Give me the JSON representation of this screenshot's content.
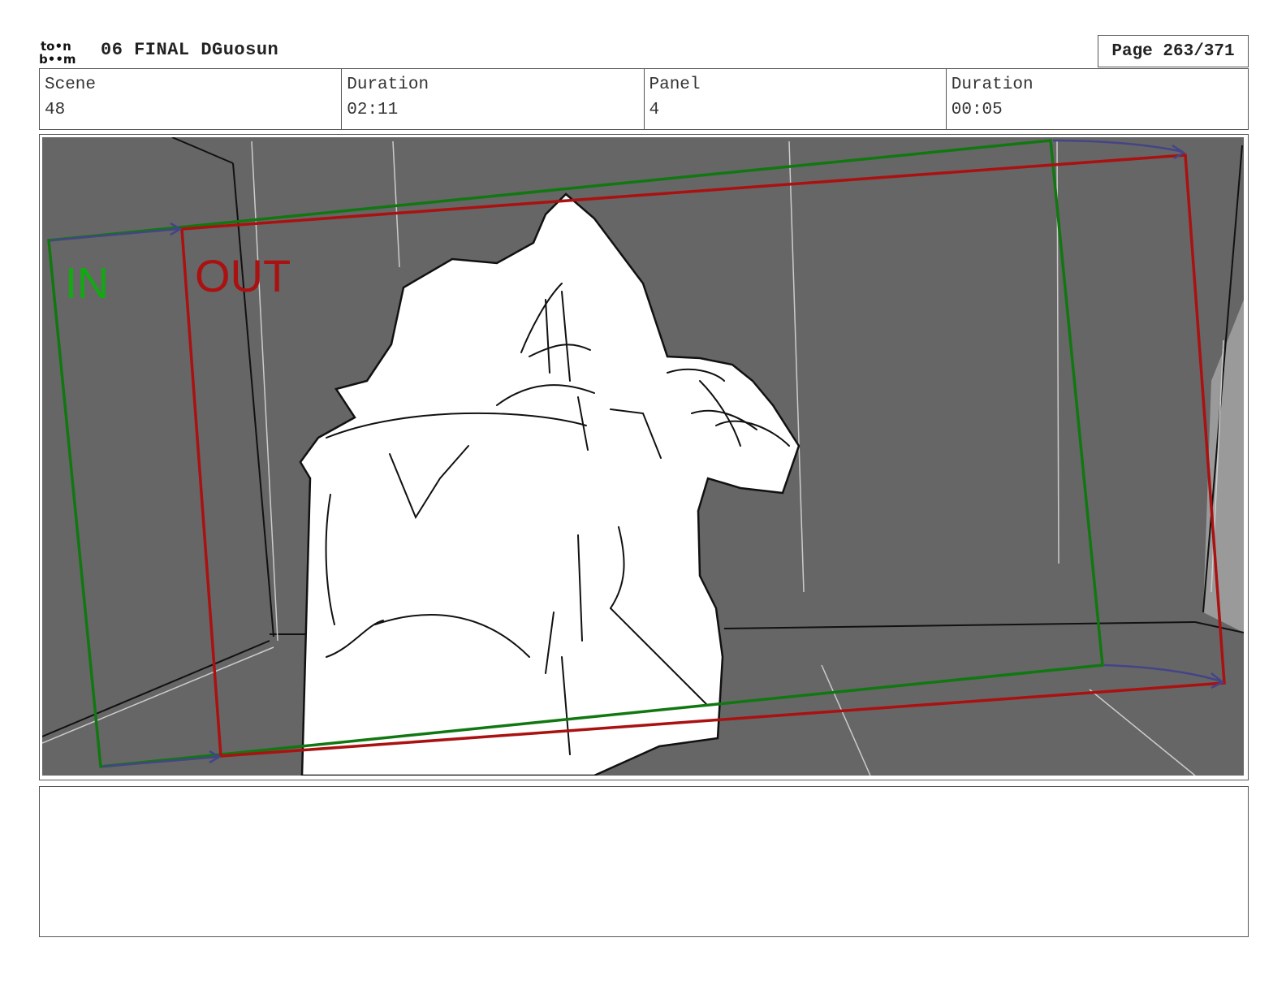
{
  "header": {
    "logo_top": "to•n",
    "logo_bottom": "b••m",
    "project_title": "06 FINAL DGuosun",
    "page_label": "Page 263/371"
  },
  "info": [
    {
      "label": "Scene",
      "value": "48"
    },
    {
      "label": "Duration",
      "value": "02:11"
    },
    {
      "label": "Panel",
      "value": "4"
    },
    {
      "label": "Duration",
      "value": "00:05"
    }
  ],
  "panel": {
    "in_label": "IN",
    "out_label": "OUT",
    "colors": {
      "background": "#666666",
      "in_frame": "#117711",
      "out_frame": "#aa1111",
      "arrow": "#444488"
    }
  },
  "notes": {
    "text": ""
  }
}
